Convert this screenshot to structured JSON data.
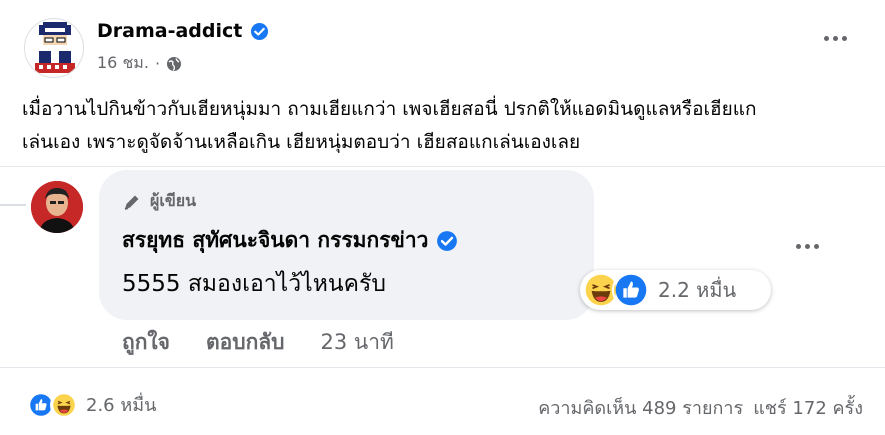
{
  "post": {
    "author": "Drama-addict",
    "time": "16 ชม.",
    "text_line1": "เมื่อวานไปกินข้าวกับเฮียหนุ่มมา ถามเฮียแกว่า เพจเฮียสอนี่ ปรกติให้แอดมินดูแลหรือเฮียแก",
    "text_line2": "เล่นเอง เพราะดูจัดจ้านเหลือเกิน เฮียหนุ่มตอบว่า เฮียสอแกเล่นเองเลย",
    "reactions_count": "2.6 หมื่น",
    "comments_label": "ความคิดเห็น 489 รายการ",
    "shares_label": "แชร์ 172 ครั้ง"
  },
  "comment": {
    "badge": "ผู้เขียน",
    "author": "สรยุทธ สุทัศนะจินดา กรรมกรข่าว",
    "text": "5555 สมองเอาไว้ไหนครับ",
    "reactions_count": "2.2 หมื่น",
    "like_label": "ถูกใจ",
    "reply_label": "ตอบกลับ",
    "time": "23 นาที"
  },
  "icons": {
    "verified": "verified-badge-icon",
    "globe": "globe-icon",
    "more": "more-dots-icon",
    "pen": "pen-icon",
    "haha": "haha-emoji-icon",
    "like": "like-thumb-icon"
  },
  "colors": {
    "accent": "#1877f2",
    "secondary_text": "#65676b",
    "bubble": "#f0f2f5",
    "haha_yellow": "#fcd34d"
  }
}
